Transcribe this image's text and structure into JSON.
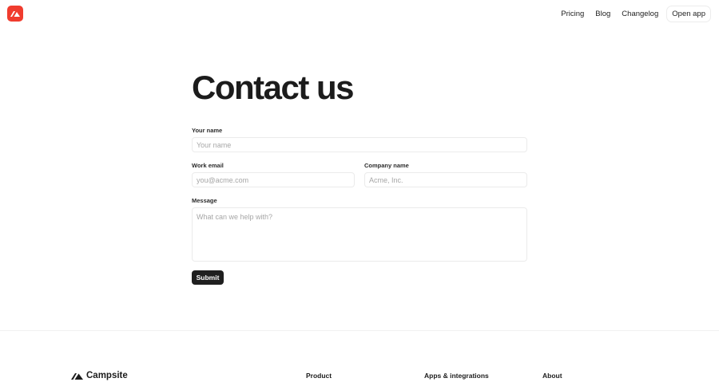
{
  "header": {
    "logo_icon": "campsite-logo-icon",
    "logo_color": "#f03c2e",
    "nav": [
      {
        "label": "Pricing"
      },
      {
        "label": "Blog"
      },
      {
        "label": "Changelog"
      },
      {
        "label": "Open app"
      }
    ]
  },
  "page": {
    "title": "Contact us"
  },
  "form": {
    "name": {
      "label": "Your name",
      "placeholder": "Your name",
      "value": ""
    },
    "email": {
      "label": "Work email",
      "placeholder": "you@acme.com",
      "value": ""
    },
    "company": {
      "label": "Company name",
      "placeholder": "Acme, Inc.",
      "value": ""
    },
    "message": {
      "label": "Message",
      "placeholder": "What can we help with?",
      "value": ""
    },
    "submit_label": "Submit"
  },
  "footer": {
    "brand_icon": "campsite-tent-icon",
    "brand_name": "Campsite",
    "columns": [
      {
        "title": "Product"
      },
      {
        "title": "Apps & integrations"
      },
      {
        "title": "About"
      }
    ]
  }
}
